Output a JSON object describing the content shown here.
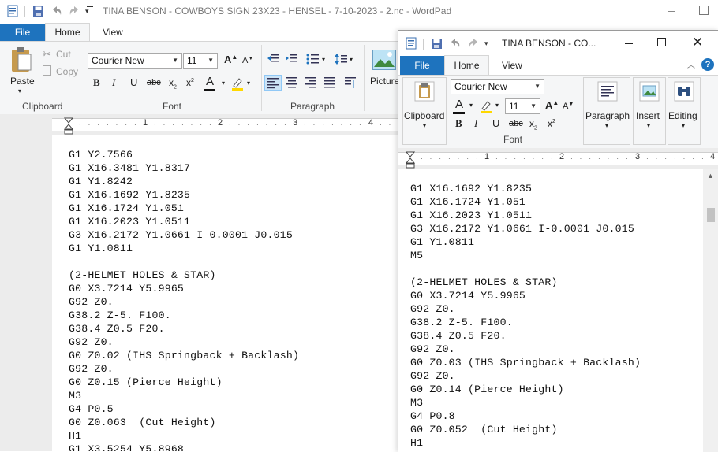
{
  "back": {
    "title": "TINA BENSON - COWBOYS SIGN 23X23 - HENSEL - 7-10-2023 - 2.nc - WordPad",
    "tabs": [
      "File",
      "Home",
      "View"
    ],
    "clipboard": {
      "paste": "Paste",
      "cut": "Cut",
      "copy": "Copy",
      "label": "Clipboard"
    },
    "font": {
      "name": "Courier New",
      "size": "11",
      "label": "Font"
    },
    "paragraph_label": "Paragraph",
    "insert": {
      "picture": "Picture"
    },
    "ruler": [
      "1",
      "2",
      "3",
      "4"
    ],
    "lines": [
      "G1 Y2.7566",
      "G1 X16.3481 Y1.8317",
      "G1 Y1.8242",
      "G1 X16.1692 Y1.8235",
      "G1 X16.1724 Y1.051",
      "G1 X16.2023 Y1.0511",
      "G3 X16.2172 Y1.0661 I-0.0001 J0.015",
      "G1 Y1.0811",
      "",
      "(2-HELMET HOLES & STAR)",
      "G0 X3.7214 Y5.9965",
      "G92 Z0.",
      "G38.2 Z-5. F100.",
      "G38.4 Z0.5 F20.",
      "G92 Z0.",
      "G0 Z0.02 (IHS Springback + Backlash)",
      "G92 Z0.",
      "G0 Z0.15 (Pierce Height)",
      "M3",
      "G4 P0.5",
      "G0 Z0.063  (Cut Height)",
      "H1",
      "G1 X3.5254 Y5.8968"
    ]
  },
  "front": {
    "title": "TINA BENSON - CO...",
    "tabs": [
      "File",
      "Home",
      "View"
    ],
    "clipboard_label": "Clipboard",
    "font": {
      "name": "Courier New",
      "size": "11",
      "label": "Font"
    },
    "groups": {
      "paragraph": "Paragraph",
      "insert": "Insert",
      "editing": "Editing"
    },
    "ruler": [
      "1",
      "2",
      "3",
      "4"
    ],
    "lines": [
      "G1 X16.1692 Y1.8235",
      "G1 X16.1724 Y1.051",
      "G1 X16.2023 Y1.0511",
      "G3 X16.2172 Y1.0661 I-0.0001 J0.015",
      "G1 Y1.0811",
      "M5",
      "",
      "(2-HELMET HOLES & STAR)",
      "G0 X3.7214 Y5.9965",
      "G92 Z0.",
      "G38.2 Z-5. F100.",
      "G38.4 Z0.5 F20.",
      "G92 Z0.",
      "G0 Z0.03 (IHS Springback + Backlash)",
      "G92 Z0.",
      "G0 Z0.14 (Pierce Height)",
      "M3",
      "G4 P0.8",
      "G0 Z0.052  (Cut Height)",
      "H1"
    ]
  },
  "colors": {
    "file_tab": "#1e73be",
    "ribbon_bg": "#f5f6f7",
    "ruler_bg": "#ececec"
  },
  "icons": [
    "wordpad-icon",
    "save-icon",
    "undo-icon",
    "redo-icon",
    "minimize-icon",
    "maximize-icon",
    "close-icon",
    "help-icon"
  ]
}
